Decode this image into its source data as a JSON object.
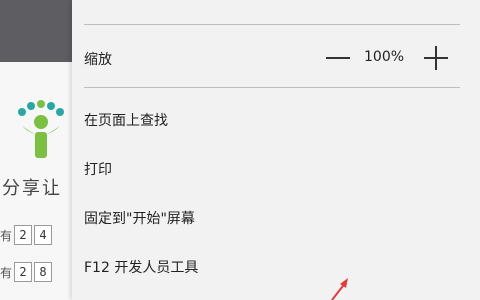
{
  "background_page": {
    "slogan": "分享让",
    "rows": [
      {
        "label": "有",
        "cells": [
          "2",
          "4"
        ]
      },
      {
        "label": "有",
        "cells": [
          "2",
          "8"
        ]
      }
    ]
  },
  "menu": {
    "zoom": {
      "label": "缩放",
      "value": "100%"
    },
    "items": [
      {
        "label": "在页面上查找"
      },
      {
        "label": "打印"
      },
      {
        "label": "固定到\"开始\"屏幕"
      },
      {
        "label": "F12 开发人员工具"
      }
    ]
  },
  "colors": {
    "menu_bg": "#f2f2f2",
    "topbar": "#5d5d62",
    "logo_teal": "#2aa6a4",
    "logo_green": "#7bc043",
    "arrow_red": "#e03c3c"
  }
}
